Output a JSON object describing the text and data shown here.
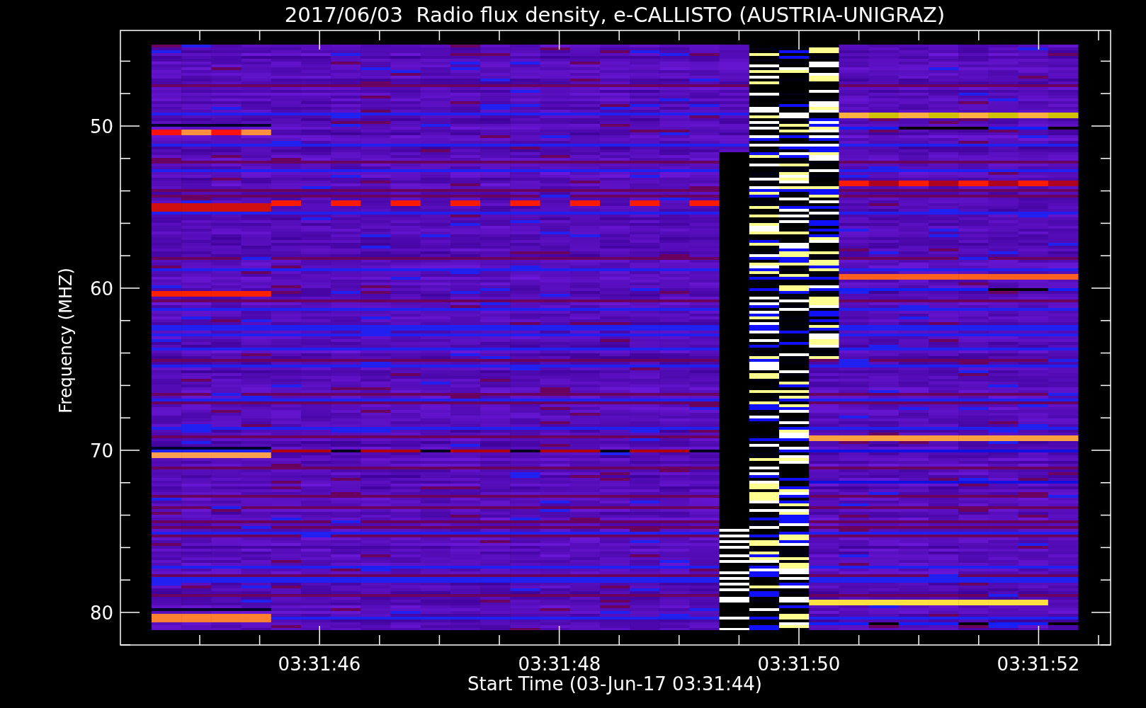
{
  "title": "2017/06/03  Radio flux density, e-CALLISTO (AUSTRIA-UNIGRAZ)",
  "y_axis": {
    "label": "Frequency (MHZ)",
    "ticks": [
      "50",
      "60",
      "70",
      "80"
    ]
  },
  "x_axis": {
    "label": "Start Time (03-Jun-17 03:31:44)",
    "ticks": [
      "03:31:46",
      "03:31:48",
      "03:31:50",
      "03:31:52"
    ]
  }
}
